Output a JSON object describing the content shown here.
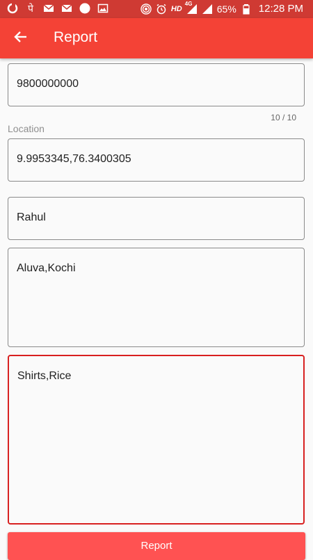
{
  "status_bar": {
    "battery_percent": "65%",
    "time": "12:28 PM",
    "hd_label": "HD",
    "network_label": "4G",
    "left_icons": [
      "sync-icon",
      "hindi-letter-icon",
      "gmail-icon",
      "gmail-icon",
      "circle-icon",
      "image-icon"
    ],
    "right_icons": [
      "hotspot-icon",
      "alarm-icon",
      "signal-icon",
      "signal-icon",
      "battery-icon"
    ]
  },
  "app_bar": {
    "title": "Report",
    "back_icon": "arrow-left-icon",
    "color": "#f44236"
  },
  "form": {
    "phone": {
      "value": "9800000000",
      "counter": "10 / 10"
    },
    "location": {
      "label": "Location",
      "value": "9.9953345,76.3400305"
    },
    "name": {
      "value": "Rahul"
    },
    "address": {
      "value": "Aluva,Kochi"
    },
    "items": {
      "value": "Shirts,Rice",
      "focused": true,
      "accent": "#d82020"
    }
  },
  "submit": {
    "label": "Report",
    "color": "#ff5252"
  }
}
